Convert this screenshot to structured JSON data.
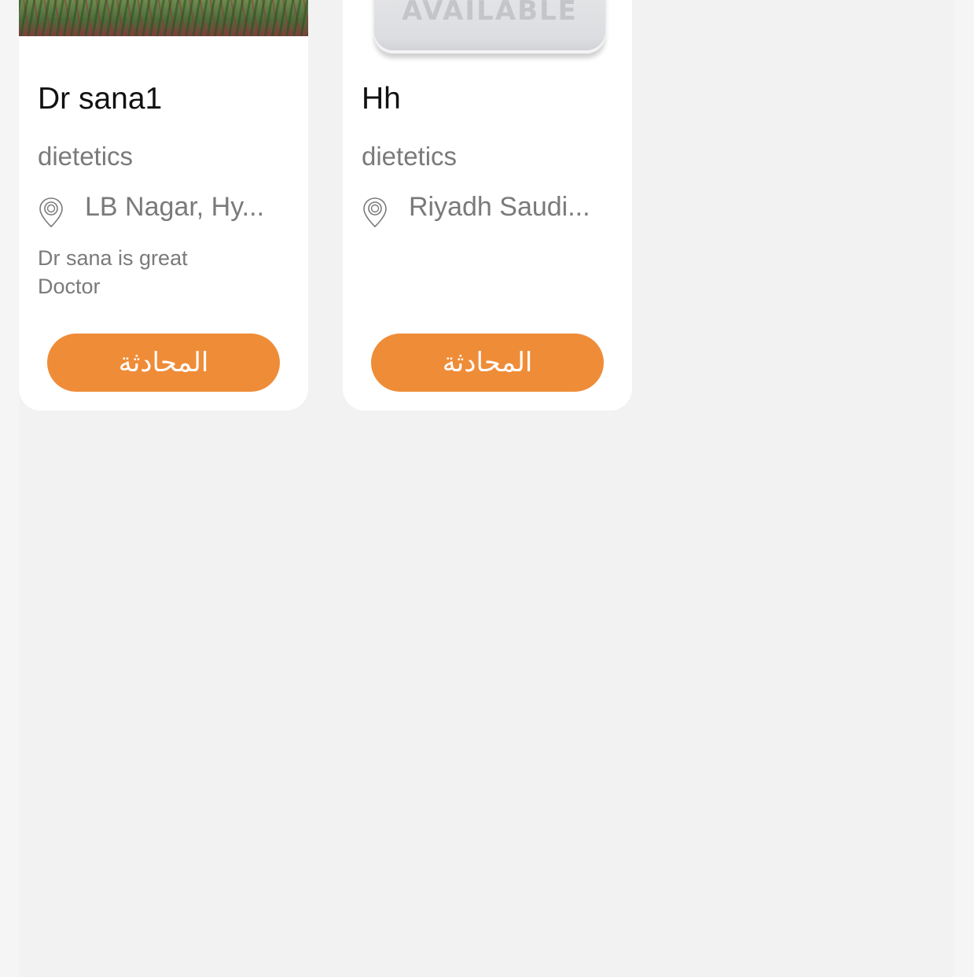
{
  "doctors": [
    {
      "name": "Dr sana1",
      "specialty": "dietetics",
      "location": "LB Nagar, Hy...",
      "bio": "Dr sana is great Doctor",
      "image": "nature-photo",
      "button_label": "المحادثة"
    },
    {
      "name": "Hh",
      "specialty": "dietetics",
      "location": "Riyadh Saudi...",
      "bio": "",
      "image": "not-available-placeholder",
      "image_text": "AVAILABLE",
      "button_label": "المحادثة"
    }
  ],
  "colors": {
    "background": "#f2f2f2",
    "card": "#ffffff",
    "accent": "#ef8c38",
    "name_text": "#111111",
    "secondary_text": "#7a7a7a"
  },
  "icons": {
    "location": "location-pin-icon"
  }
}
